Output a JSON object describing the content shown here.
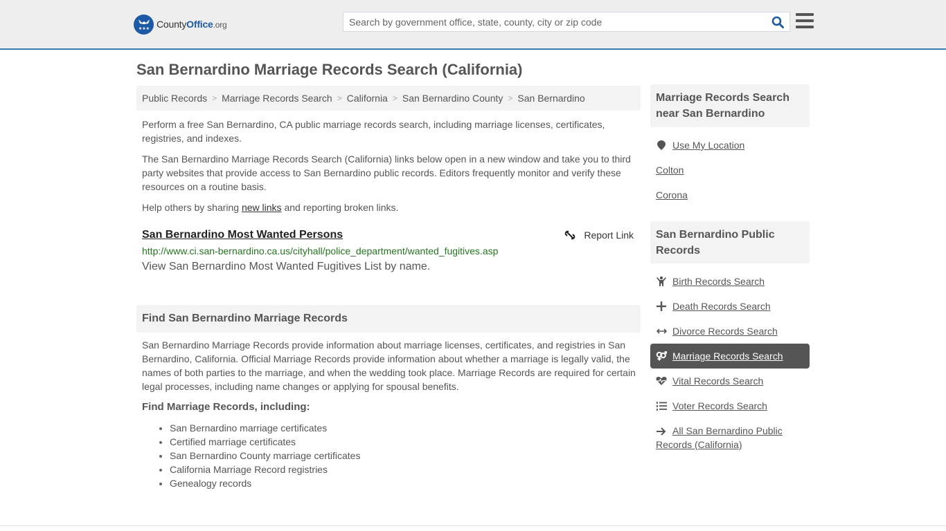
{
  "header": {
    "logo": {
      "prefix": "County",
      "highlight": "Office",
      "suffix": ".org"
    },
    "search_placeholder": "Search by government office, state, county, city or zip code",
    "search_icon": "search-icon",
    "menu_icon": "hamburger-menu-icon"
  },
  "page": {
    "title": "San Bernardino Marriage Records Search (California)"
  },
  "breadcrumb": [
    "Public Records",
    "Marriage Records Search",
    "California",
    "San Bernardino County",
    "San Bernardino"
  ],
  "intro": {
    "p1": "Perform a free San Bernardino, CA public marriage records search, including marriage licenses, certificates, registries, and indexes.",
    "p2": "The San Bernardino Marriage Records Search (California) links below open in a new window and take you to third party websites that provide access to San Bernardino public records. Editors frequently monitor and verify these resources on a routine basis.",
    "p3_before": "Help others by sharing ",
    "p3_link": "new links",
    "p3_after": " and reporting broken links."
  },
  "results": [
    {
      "title": "San Bernardino Most Wanted Persons",
      "url": "http://www.ci.san-bernardino.ca.us/cityhall/police_department/wanted_fugitives.asp",
      "description": "View San Bernardino Most Wanted Fugitives List by name.",
      "report_label": "Report Link"
    }
  ],
  "find_section": {
    "heading": "Find San Bernardino Marriage Records",
    "body": "San Bernardino Marriage Records provide information about marriage licenses, certificates, and registries in San Bernardino, California. Official Marriage Records provide information about whether a marriage is legally valid, the names of both parties to the marriage, and when the wedding took place. Marriage Records are required for certain legal processes, including name changes or applying for spousal benefits.",
    "subheading": "Find Marriage Records, including:",
    "items": [
      "San Bernardino marriage certificates",
      "Certified marriage certificates",
      "San Bernardino County marriage certificates",
      "California Marriage Record registries",
      "Genealogy records"
    ]
  },
  "sidebar": {
    "nearby": {
      "heading": "Marriage Records Search near San Bernardino",
      "use_location": "Use My Location",
      "places": [
        "Colton",
        "Corona"
      ]
    },
    "public_records": {
      "heading": "San Bernardino Public Records",
      "items": [
        {
          "label": "Birth Records Search",
          "icon": "child-icon",
          "active": false
        },
        {
          "label": "Death Records Search",
          "icon": "cross-icon",
          "active": false
        },
        {
          "label": "Divorce Records Search",
          "icon": "arrows-horizontal-icon",
          "active": false
        },
        {
          "label": "Marriage Records Search",
          "icon": "venus-mars-icon",
          "active": true
        },
        {
          "label": "Vital Records Search",
          "icon": "heartbeat-icon",
          "active": false
        },
        {
          "label": "Voter Records Search",
          "icon": "list-ordered-icon",
          "active": false
        },
        {
          "label": "All San Bernardino Public Records (California)",
          "icon": "arrow-right-icon",
          "active": false
        }
      ]
    }
  },
  "colors": {
    "accent_blue": "#1d5aa5",
    "header_border": "#3a7ab0",
    "url_green": "#267321",
    "active_bg": "#555555"
  }
}
